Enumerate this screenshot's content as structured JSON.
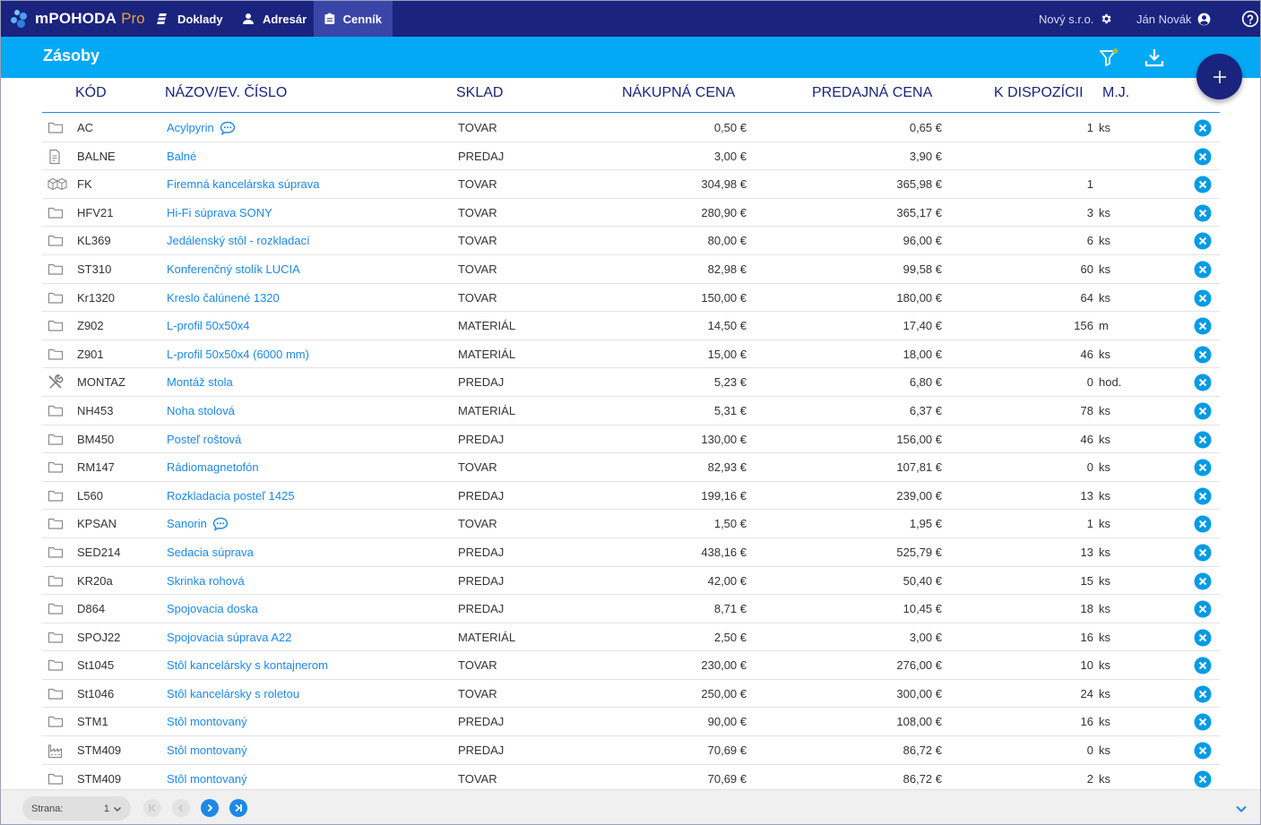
{
  "app": {
    "name": "mPOHODA",
    "edition": "Pro"
  },
  "nav": [
    {
      "label": "Doklady",
      "icon": "documents-icon",
      "active": false
    },
    {
      "label": "Adresár",
      "icon": "person-icon",
      "active": false
    },
    {
      "label": "Cenník",
      "icon": "pricelist-icon",
      "active": true
    }
  ],
  "company": {
    "name": "Nový s.r.o.",
    "icon": "gear-icon"
  },
  "user": {
    "name": "Ján Novák",
    "icon": "account-icon"
  },
  "help_icon": "help-icon",
  "page": {
    "title": "Zásoby"
  },
  "toolbar": {
    "filter_icon": "filter-icon",
    "filter_active_color": "#8bc34a",
    "download_icon": "download-icon",
    "add_icon": "plus-icon"
  },
  "table": {
    "headers": {
      "code": "KÓD",
      "name": "NÁZOV/EV. ČÍSLO",
      "store": "SKLAD",
      "buy": "NÁKUPNÁ CENA",
      "sell": "PREDAJNÁ CENA",
      "avail": "K DISPOZÍCII",
      "unit": "M.J."
    },
    "rows": [
      {
        "icon": "folder-icon",
        "code": "AC",
        "name": "Acylpyrin",
        "comment": true,
        "store": "TOVAR",
        "buy": "0,50 €",
        "sell": "0,65 €",
        "avail": "1",
        "unit": "ks"
      },
      {
        "icon": "document-icon",
        "code": "BALNE",
        "name": "Balné",
        "comment": false,
        "store": "PREDAJ",
        "buy": "3,00 €",
        "sell": "3,90 €",
        "avail": "",
        "unit": ""
      },
      {
        "icon": "boxes-icon",
        "code": "FK",
        "name": "Firemná kancelárska súprava",
        "comment": false,
        "store": "TOVAR",
        "buy": "304,98 €",
        "sell": "365,98 €",
        "avail": "1",
        "unit": ""
      },
      {
        "icon": "folder-icon",
        "code": "HFV21",
        "name": "Hi-Fi súprava SONY",
        "comment": false,
        "store": "TOVAR",
        "buy": "280,90 €",
        "sell": "365,17 €",
        "avail": "3",
        "unit": "ks"
      },
      {
        "icon": "folder-icon",
        "code": "KL369",
        "name": "Jedálenský stôl - rozkladací",
        "comment": false,
        "store": "TOVAR",
        "buy": "80,00 €",
        "sell": "96,00 €",
        "avail": "6",
        "unit": "ks"
      },
      {
        "icon": "folder-icon",
        "code": "ST310",
        "name": "Konferenčný stolík LUCIA",
        "comment": false,
        "store": "TOVAR",
        "buy": "82,98 €",
        "sell": "99,58 €",
        "avail": "60",
        "unit": "ks"
      },
      {
        "icon": "folder-icon",
        "code": "Kr1320",
        "name": "Kreslo čalúnené 1320",
        "comment": false,
        "store": "TOVAR",
        "buy": "150,00 €",
        "sell": "180,00 €",
        "avail": "64",
        "unit": "ks"
      },
      {
        "icon": "folder-icon",
        "code": "Z902",
        "name": "L-profil 50x50x4",
        "comment": false,
        "store": "MATERIÁL",
        "buy": "14,50 €",
        "sell": "17,40 €",
        "avail": "156",
        "unit": "m"
      },
      {
        "icon": "folder-icon",
        "code": "Z901",
        "name": "L-profil 50x50x4 (6000 mm)",
        "comment": false,
        "store": "MATERIÁL",
        "buy": "15,00 €",
        "sell": "18,00 €",
        "avail": "46",
        "unit": "ks"
      },
      {
        "icon": "tools-icon",
        "code": "MONTAZ",
        "name": "Montáž stola",
        "comment": false,
        "store": "PREDAJ",
        "buy": "5,23 €",
        "sell": "6,80 €",
        "avail": "0",
        "unit": "hod."
      },
      {
        "icon": "folder-icon",
        "code": "NH453",
        "name": "Noha stolová",
        "comment": false,
        "store": "MATERIÁL",
        "buy": "5,31 €",
        "sell": "6,37 €",
        "avail": "78",
        "unit": "ks"
      },
      {
        "icon": "folder-icon",
        "code": "BM450",
        "name": "Posteľ roštová",
        "comment": false,
        "store": "PREDAJ",
        "buy": "130,00 €",
        "sell": "156,00 €",
        "avail": "46",
        "unit": "ks"
      },
      {
        "icon": "folder-icon",
        "code": "RM147",
        "name": "Rádiomagnetofón",
        "comment": false,
        "store": "TOVAR",
        "buy": "82,93 €",
        "sell": "107,81 €",
        "avail": "0",
        "unit": "ks"
      },
      {
        "icon": "folder-icon",
        "code": "L560",
        "name": "Rozkladacia posteľ 1425",
        "comment": false,
        "store": "PREDAJ",
        "buy": "199,16 €",
        "sell": "239,00 €",
        "avail": "13",
        "unit": "ks"
      },
      {
        "icon": "folder-icon",
        "code": "KPSAN",
        "name": "Sanorin",
        "comment": true,
        "store": "TOVAR",
        "buy": "1,50 €",
        "sell": "1,95 €",
        "avail": "1",
        "unit": "ks"
      },
      {
        "icon": "folder-icon",
        "code": "SED214",
        "name": "Sedacia súprava",
        "comment": false,
        "store": "PREDAJ",
        "buy": "438,16 €",
        "sell": "525,79 €",
        "avail": "13",
        "unit": "ks"
      },
      {
        "icon": "folder-icon",
        "code": "KR20a",
        "name": "Skrinka rohová",
        "comment": false,
        "store": "PREDAJ",
        "buy": "42,00 €",
        "sell": "50,40 €",
        "avail": "15",
        "unit": "ks"
      },
      {
        "icon": "folder-icon",
        "code": "D864",
        "name": "Spojovacia doska",
        "comment": false,
        "store": "PREDAJ",
        "buy": "8,71 €",
        "sell": "10,45 €",
        "avail": "18",
        "unit": "ks"
      },
      {
        "icon": "folder-icon",
        "code": "SPOJ22",
        "name": "Spojovacia súprava A22",
        "comment": false,
        "store": "MATERIÁL",
        "buy": "2,50 €",
        "sell": "3,00 €",
        "avail": "16",
        "unit": "ks"
      },
      {
        "icon": "folder-icon",
        "code": "St1045",
        "name": "Stôl kancelársky s kontajnerom",
        "comment": false,
        "store": "TOVAR",
        "buy": "230,00 €",
        "sell": "276,00 €",
        "avail": "10",
        "unit": "ks"
      },
      {
        "icon": "folder-icon",
        "code": "St1046",
        "name": "Stôl kancelársky s roletou",
        "comment": false,
        "store": "TOVAR",
        "buy": "250,00 €",
        "sell": "300,00 €",
        "avail": "24",
        "unit": "ks"
      },
      {
        "icon": "folder-icon",
        "code": "STM1",
        "name": "Stôl montovaný",
        "comment": false,
        "store": "PREDAJ",
        "buy": "90,00 €",
        "sell": "108,00 €",
        "avail": "16",
        "unit": "ks"
      },
      {
        "icon": "factory-icon",
        "code": "STM409",
        "name": "Stôl montovaný",
        "comment": false,
        "store": "PREDAJ",
        "buy": "70,69 €",
        "sell": "86,72 €",
        "avail": "0",
        "unit": "ks"
      },
      {
        "icon": "folder-icon",
        "code": "STM409",
        "name": "Stôl montovaný",
        "comment": false,
        "store": "TOVAR",
        "buy": "70,69 €",
        "sell": "86,72 €",
        "avail": "2",
        "unit": "ks"
      }
    ]
  },
  "pagination": {
    "label": "Strana:",
    "current": "1"
  },
  "colors": {
    "nav_bg": "#1a237e",
    "header_bg": "#03a9f4",
    "link": "#1e88e5",
    "delete": "#039be5",
    "brand_pro": "#f0a23c"
  }
}
